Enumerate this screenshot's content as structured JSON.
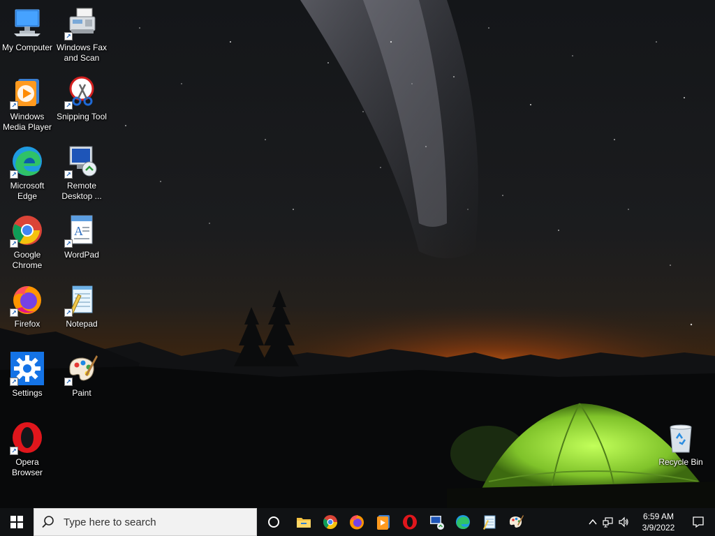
{
  "desktop": {
    "icons": [
      {
        "label": "My Computer"
      },
      {
        "label": "Windows Fax and Scan"
      },
      {
        "label": "Windows Media Player"
      },
      {
        "label": "Snipping Tool"
      },
      {
        "label": "Microsoft Edge"
      },
      {
        "label": "Remote Desktop ..."
      },
      {
        "label": "Google Chrome"
      },
      {
        "label": "WordPad"
      },
      {
        "label": "Firefox"
      },
      {
        "label": "Notepad"
      },
      {
        "label": "Settings"
      },
      {
        "label": "Paint"
      },
      {
        "label": "Opera Browser"
      },
      {
        "label": "Recycle Bin"
      }
    ]
  },
  "taskbar": {
    "search_placeholder": "Type here to search",
    "pinned": [
      "file-explorer-icon",
      "chrome-icon",
      "firefox-icon",
      "media-player-icon",
      "opera-icon",
      "remote-desktop-icon",
      "edge-icon",
      "notepad-icon",
      "paint-icon"
    ],
    "clock": {
      "time": "6:59 AM",
      "date": "3/9/2022"
    }
  },
  "colors": {
    "taskbar_bg": "#101214",
    "tent_green": "#8fd63a",
    "horizon_orange": "#ff7a1a",
    "windows_blue": "#1473e6"
  }
}
